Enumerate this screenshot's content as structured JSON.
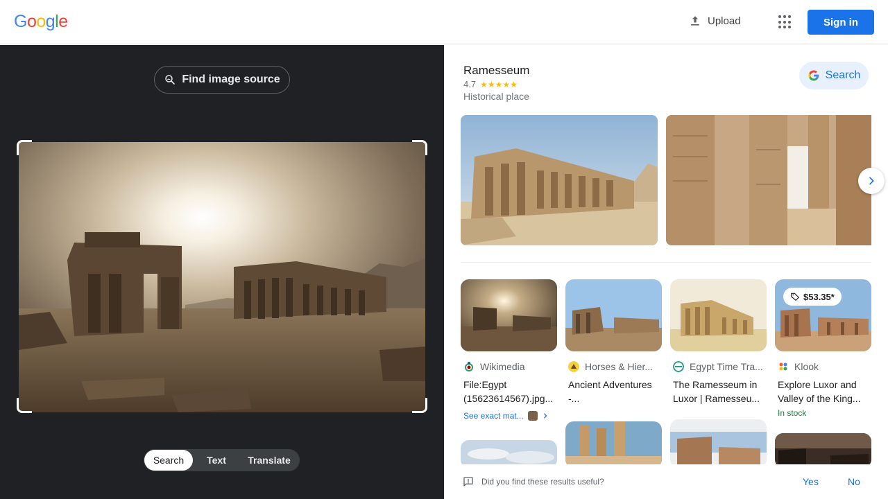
{
  "header": {
    "logo_letters": [
      "G",
      "o",
      "o",
      "g",
      "l",
      "e"
    ],
    "logo_colors": [
      "#4285f4",
      "#ea4335",
      "#fbbc05",
      "#4285f4",
      "#34a853",
      "#ea4335"
    ],
    "upload_label": "Upload",
    "apps_icon": "apps-grid-icon",
    "sign_in_label": "Sign in"
  },
  "lens": {
    "find_source_label": "Find image source",
    "modes": [
      "Search",
      "Text",
      "Translate"
    ],
    "active_mode": "Search"
  },
  "knowledge": {
    "title": "Ramesseum",
    "rating": "4.7",
    "stars_display": "★★★★★",
    "type": "Historical place",
    "search_label": "Search"
  },
  "results": [
    {
      "source": "Wikimedia",
      "title": "File:Egypt (15623614567).jpg...",
      "extra": "See exact mat..."
    },
    {
      "source": "Horses & Hier...",
      "title": "Ancient Adventures -..."
    },
    {
      "source": "Egypt Time Tra...",
      "title": "The Ramesseum in Luxor | Ramesseu..."
    },
    {
      "source": "Klook",
      "title": "Explore Luxor and Valley of the King...",
      "price": "$53.35*",
      "stock": "In stock"
    }
  ],
  "feedback": {
    "question": "Did you find these results useful?",
    "yes": "Yes",
    "no": "No"
  },
  "colors": {
    "accent": "#1a73e8",
    "dark_panel": "#202124",
    "star": "#fbbc04",
    "in_stock": "#188038"
  }
}
